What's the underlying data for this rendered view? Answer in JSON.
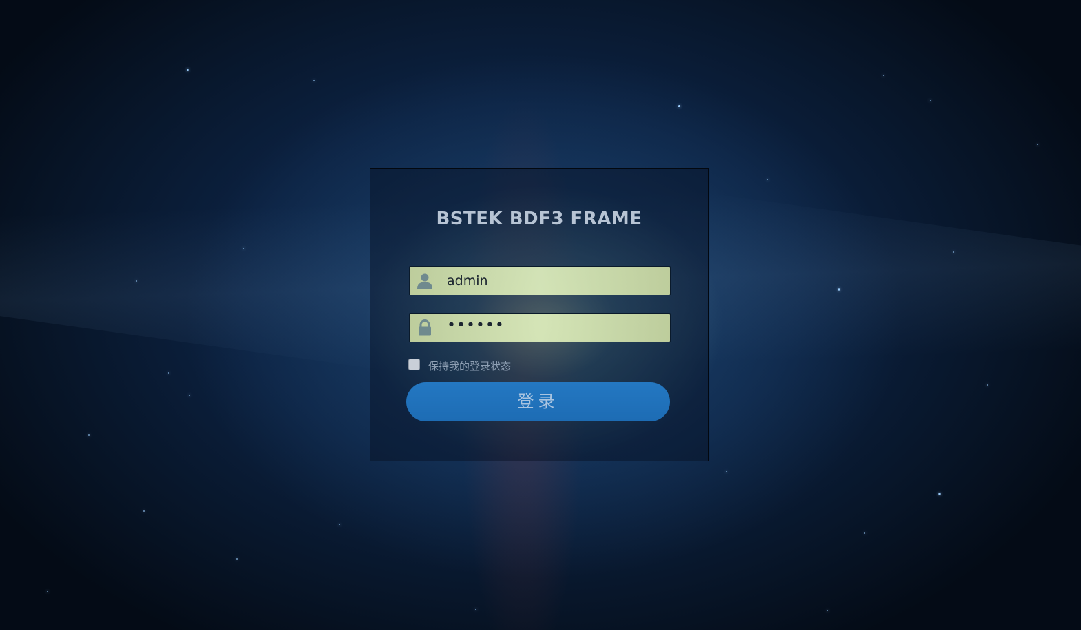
{
  "page": {
    "title": "BSTEK BDF3 FRAME"
  },
  "login_form": {
    "username": {
      "value": "admin",
      "icon": "user-icon"
    },
    "password": {
      "value": "••••••",
      "icon": "lock-icon"
    },
    "remember_me": {
      "label": "保持我的登录状态",
      "checked": false
    },
    "submit_label": "登录"
  },
  "colors": {
    "button": "#1d6cb4",
    "title": "#b7c4d4",
    "field_background": "#dde8b4",
    "background": "#0c2242"
  }
}
